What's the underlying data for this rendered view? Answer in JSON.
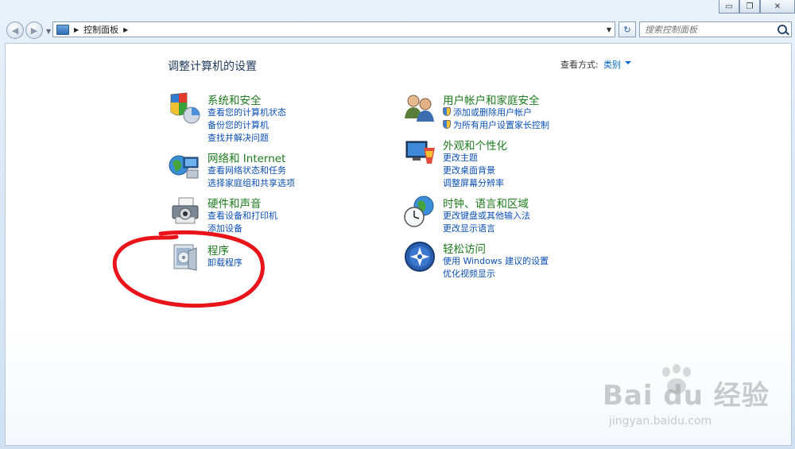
{
  "window": {
    "buttons": {
      "minimize": "▭",
      "maximize": "❐",
      "close": "✕"
    }
  },
  "nav": {
    "breadcrumb": "控制面板",
    "search_placeholder": "搜索控制面板",
    "refresh_icon": "refresh-icon"
  },
  "header": {
    "title": "调整计算机的设置",
    "view_by_label": "查看方式:",
    "view_by_value": "类别"
  },
  "categories": [
    {
      "title": "系统和安全",
      "icon": "system-security-icon",
      "links": [
        "查看您的计算机状态",
        "备份您的计算机",
        "查找并解决问题"
      ]
    },
    {
      "title": "网络和 Internet",
      "icon": "network-icon",
      "links": [
        "查看网络状态和任务",
        "选择家庭组和共享选项"
      ]
    },
    {
      "title": "硬件和声音",
      "icon": "hardware-sound-icon",
      "links": [
        "查看设备和打印机",
        "添加设备"
      ]
    },
    {
      "title": "程序",
      "icon": "programs-icon",
      "links": [
        "卸载程序"
      ]
    },
    {
      "title": "用户帐户和家庭安全",
      "icon": "user-accounts-icon",
      "links": [
        "添加或删除用户帐户",
        "为所有用户设置家长控制"
      ]
    },
    {
      "title": "外观和个性化",
      "icon": "appearance-icon",
      "links": [
        "更改主题",
        "更改桌面背景",
        "调整屏幕分辨率"
      ]
    },
    {
      "title": "时钟、语言和区域",
      "icon": "clock-region-icon",
      "links": [
        "更改键盘或其他输入法",
        "更改显示语言"
      ]
    },
    {
      "title": "轻松访问",
      "icon": "ease-of-access-icon",
      "links": [
        "使用 Windows 建议的设置",
        "优化视频显示"
      ]
    }
  ],
  "watermark": {
    "brand": "Bai du 经验",
    "url": "jingyan.baidu.com"
  },
  "colors": {
    "category_title": "#1d7a1d",
    "link": "#0b4fb4",
    "annotation": "#e8141a"
  }
}
